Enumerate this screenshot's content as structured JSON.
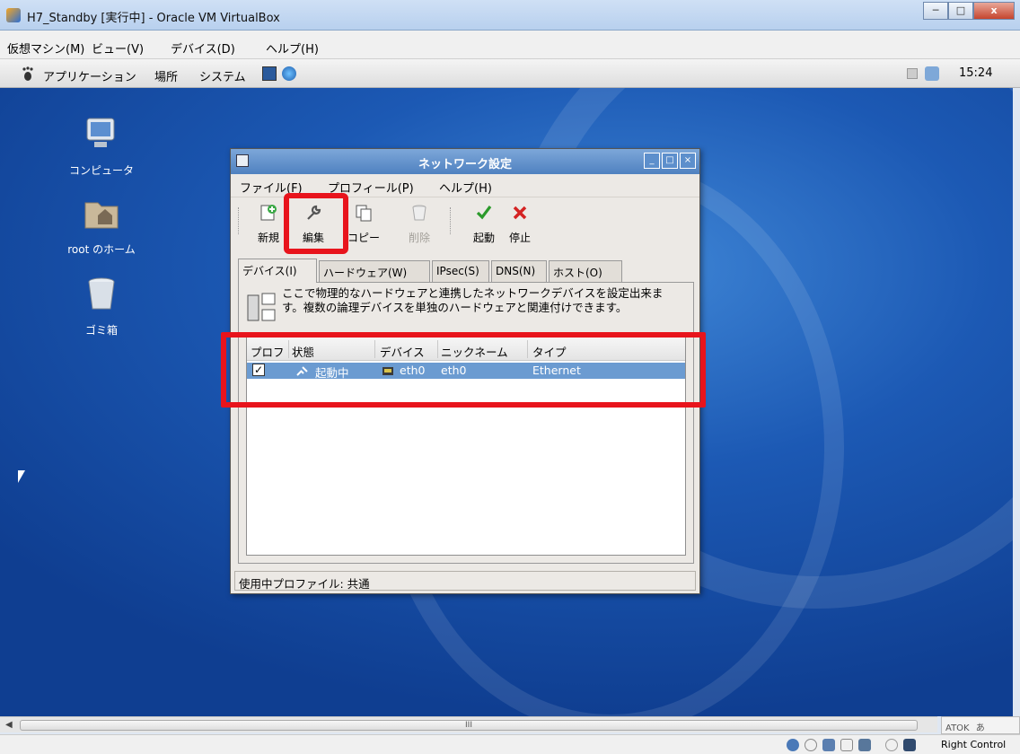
{
  "host": {
    "title": "H7_Standby [実行中] - Oracle VM VirtualBox",
    "menu": [
      "仮想マシン(M)",
      "ビュー(V)",
      "デバイス(D)",
      "ヘルプ(H)"
    ],
    "status_right": "Right Control",
    "ime": "ATOK",
    "ime_mode": "あ",
    "scroll_label": "III",
    "window_buttons": {
      "minimize": "─",
      "maximize": "□",
      "close": "x"
    }
  },
  "gnome": {
    "panel": [
      "アプリケーション",
      "場所",
      "システム"
    ],
    "clock": "15:24"
  },
  "desktop": {
    "icons": [
      "コンピュータ",
      "root のホーム",
      "ゴミ箱"
    ]
  },
  "dialog": {
    "title": "ネットワーク設定",
    "menu": [
      "ファイル(F)",
      "プロフィール(P)",
      "ヘルプ(H)"
    ],
    "toolbar": {
      "new": "新規",
      "edit": "編集",
      "copy": "コピー",
      "delete": "削除",
      "activate": "起動",
      "deactivate": "停止"
    },
    "tabs": [
      "デバイス(I)",
      "ハードウェア(W)",
      "IPsec(S)",
      "DNS(N)",
      "ホスト(O)"
    ],
    "description": "ここで物理的なハードウェアと連携したネットワークデバイスを設定出来ます。複数の論理デバイスを単独のハードウェアと関連付けできます。",
    "columns": [
      "プロフ",
      "状態",
      "デバイス",
      "ニックネーム",
      "タイプ"
    ],
    "rows": [
      {
        "checked": "✓",
        "status": "起動中",
        "device": "eth0",
        "nickname": "eth0",
        "type": "Ethernet"
      }
    ],
    "status_bar": "使用中プロファイル: 共通"
  }
}
